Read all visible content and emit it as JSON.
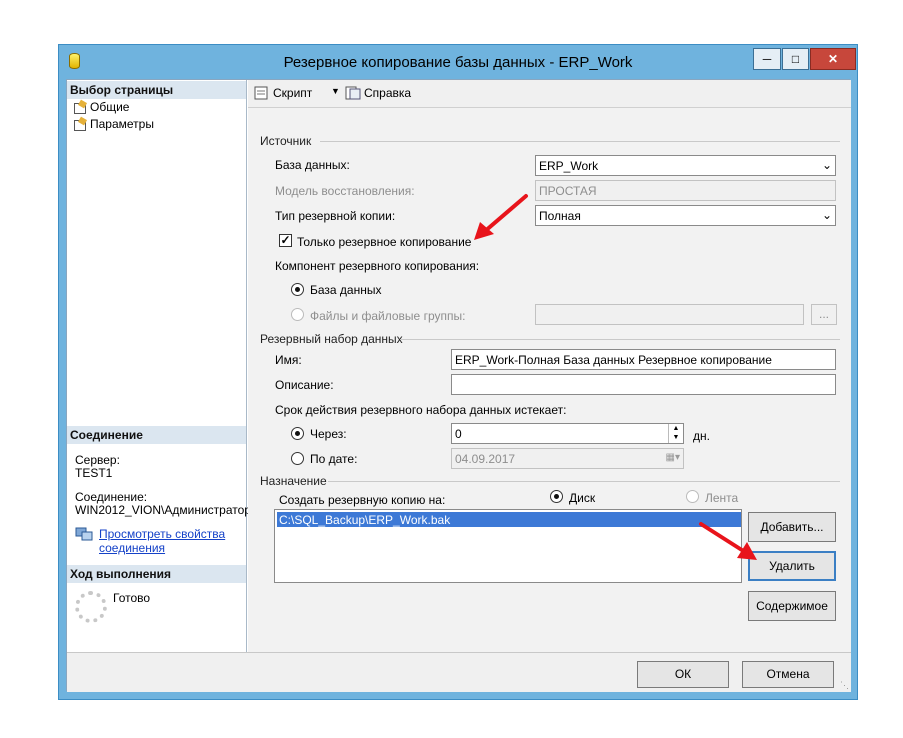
{
  "window": {
    "title": "Резервное копирование базы данных - ERP_Work"
  },
  "left": {
    "select_page_header": "Выбор страницы",
    "pages": [
      "Общие",
      "Параметры"
    ],
    "connection_header": "Соединение",
    "server_label": "Сервер:",
    "server_value": "TEST1",
    "connection_label": "Соединение:",
    "connection_value": "WIN2012_VION\\Администратор",
    "view_props_link_1": "Просмотреть свойства",
    "view_props_link_2": "соединения",
    "progress_header": "Ход выполнения",
    "progress_status": "Готово"
  },
  "toolbar": {
    "script": "Скрипт",
    "help": "Справка"
  },
  "source": {
    "group": "Источник",
    "database_label": "База данных:",
    "database_value": "ERP_Work",
    "recovery_label": "Модель восстановления:",
    "recovery_value": "ПРОСТАЯ",
    "type_label": "Тип резервной копии:",
    "type_value": "Полная",
    "copy_only": "Только резервное копирование",
    "component_label": "Компонент резервного копирования:",
    "component_db": "База данных",
    "component_files": "Файлы и файловые группы:",
    "browse": "..."
  },
  "backup_set": {
    "group": "Резервный набор данных",
    "name_label": "Имя:",
    "name_value": "ERP_Work-Полная База данных Резервное копирование",
    "desc_label": "Описание:",
    "desc_value": "",
    "expire_label": "Срок действия резервного набора данных истекает:",
    "after_label": "Через:",
    "after_value": "0",
    "days": "дн.",
    "on_label": "По дате:",
    "on_value": "04.09.2017"
  },
  "destination": {
    "group": "Назначение",
    "backup_to_label": "Создать резервную копию на:",
    "disk": "Диск",
    "tape": "Лента",
    "files": [
      "C:\\SQL_Backup\\ERP_Work.bak"
    ],
    "add": "Добавить...",
    "remove": "Удалить",
    "contents": "Содержимое"
  },
  "footer": {
    "ok": "ОК",
    "cancel": "Отмена"
  },
  "colors": {
    "title_bar": "#6fb3de",
    "close_button": "#c7473b",
    "selection": "#3d79d6",
    "annotation_arrow": "#e8141b"
  }
}
